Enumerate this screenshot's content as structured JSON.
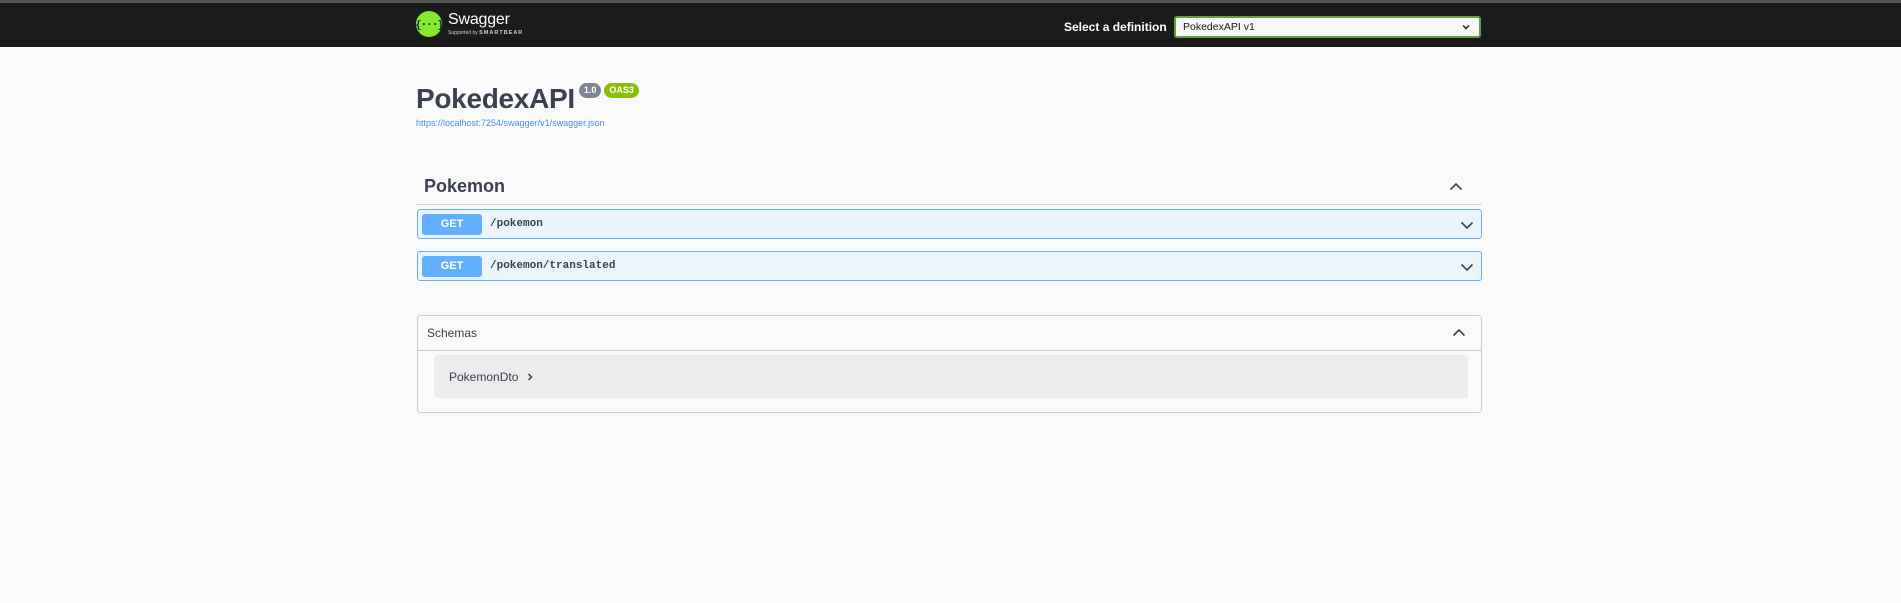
{
  "topbar": {
    "brand_name": "Swagger",
    "brand_sub_prefix": "Supported by",
    "brand_sub_company": "SMARTBEAR",
    "logo_glyph": "{···}",
    "definition_label": "Select a definition",
    "definition_selected": "PokedexAPI v1"
  },
  "info": {
    "title": "PokedexAPI",
    "version_badge": "1.0",
    "oas_badge": "OAS3",
    "spec_url": "https://localhost:7254/swagger/v1/swagger.json"
  },
  "tag": {
    "name": "Pokemon",
    "operations": [
      {
        "method": "GET",
        "path": "/pokemon"
      },
      {
        "method": "GET",
        "path": "/pokemon/translated"
      }
    ]
  },
  "schemas": {
    "title": "Schemas",
    "models": [
      {
        "name": "PokemonDto"
      }
    ]
  },
  "colors": {
    "topbar_bg": "#1b1b1b",
    "logo_green": "#85ea2d",
    "get_blue": "#61affe",
    "get_bg": "#ebf3fb"
  }
}
